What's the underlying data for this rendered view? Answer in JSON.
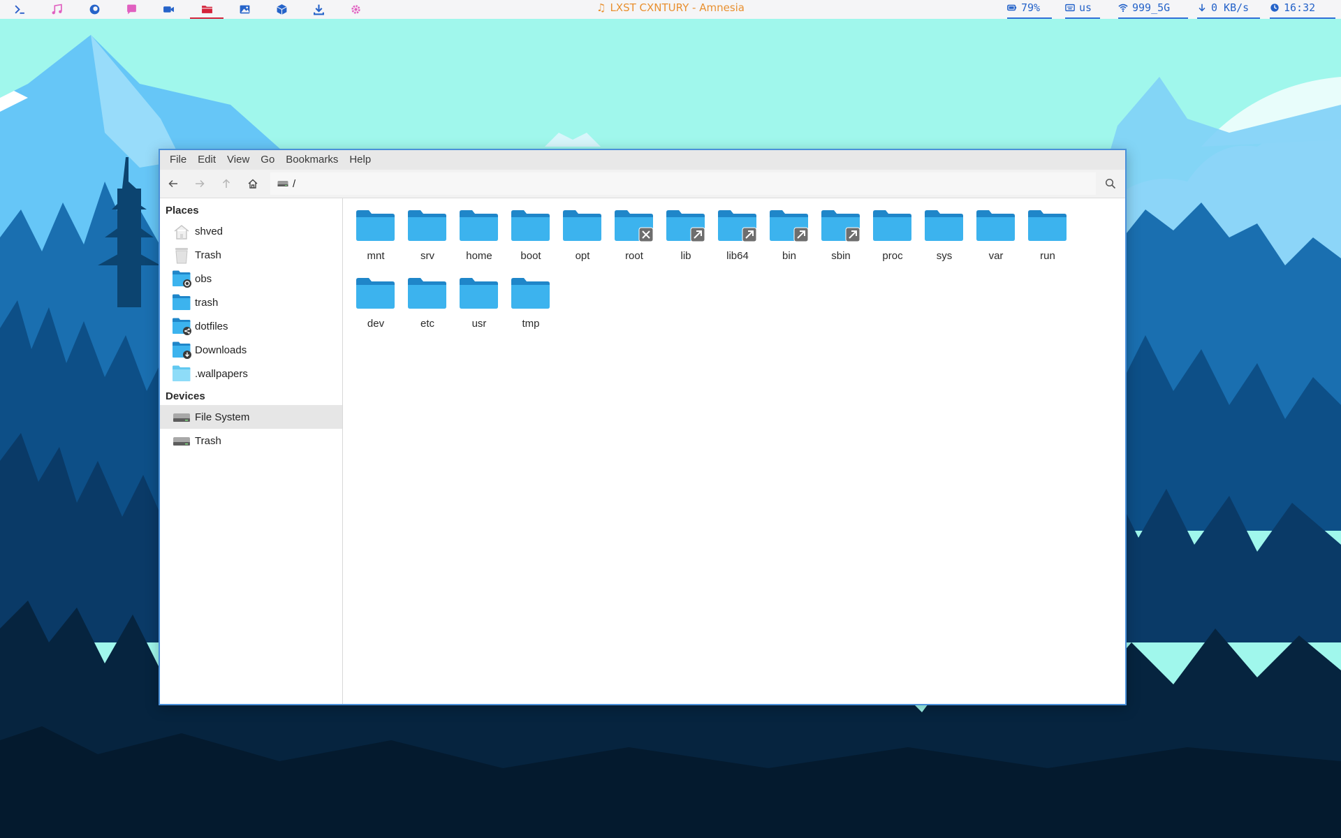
{
  "topbar": {
    "apps": [
      {
        "name": "terminal-icon",
        "color": "#2d5fc9"
      },
      {
        "name": "music-icon",
        "color": "#e060c0"
      },
      {
        "name": "firefox-icon",
        "color": "#2563c9"
      },
      {
        "name": "chat-icon",
        "color": "#e060c0"
      },
      {
        "name": "video-icon",
        "color": "#2563c9"
      },
      {
        "name": "folder-icon",
        "color": "#d4233a",
        "active": true
      },
      {
        "name": "image-icon",
        "color": "#2563c9"
      },
      {
        "name": "package-icon",
        "color": "#2563c9"
      },
      {
        "name": "download-icon",
        "color": "#2563c9"
      },
      {
        "name": "settings-icon",
        "color": "#e060c0"
      }
    ],
    "now_playing": "LXST CXNTURY - Amnesia",
    "battery": "79%",
    "keyboard": "us",
    "wifi": "999_5G",
    "network": "0 KB/s",
    "clock": "16:32"
  },
  "window": {
    "menu": [
      "File",
      "Edit",
      "View",
      "Go",
      "Bookmarks",
      "Help"
    ],
    "location_path": "/",
    "sidebar": {
      "places_heading": "Places",
      "places": [
        {
          "label": "shved",
          "icon": "home-icon"
        },
        {
          "label": "Trash",
          "icon": "trash-icon"
        },
        {
          "label": "obs",
          "icon": "folder-camera-icon"
        },
        {
          "label": "trash",
          "icon": "folder-icon"
        },
        {
          "label": "dotfiles",
          "icon": "folder-share-icon"
        },
        {
          "label": "Downloads",
          "icon": "folder-download-icon"
        },
        {
          "label": ".wallpapers",
          "icon": "folder-light-icon"
        }
      ],
      "devices_heading": "Devices",
      "devices": [
        {
          "label": "File System",
          "icon": "drive-icon",
          "selected": true
        },
        {
          "label": "Trash",
          "icon": "drive-icon"
        }
      ]
    },
    "files": [
      {
        "label": "mnt",
        "badge": ""
      },
      {
        "label": "srv",
        "badge": ""
      },
      {
        "label": "home",
        "badge": ""
      },
      {
        "label": "boot",
        "badge": ""
      },
      {
        "label": "opt",
        "badge": ""
      },
      {
        "label": "root",
        "badge": "locked"
      },
      {
        "label": "lib",
        "badge": "link"
      },
      {
        "label": "lib64",
        "badge": "link"
      },
      {
        "label": "bin",
        "badge": "link"
      },
      {
        "label": "sbin",
        "badge": "link"
      },
      {
        "label": "proc",
        "badge": ""
      },
      {
        "label": "sys",
        "badge": ""
      },
      {
        "label": "var",
        "badge": ""
      },
      {
        "label": "run",
        "badge": ""
      },
      {
        "label": "dev",
        "badge": ""
      },
      {
        "label": "etc",
        "badge": ""
      },
      {
        "label": "usr",
        "badge": ""
      },
      {
        "label": "tmp",
        "badge": ""
      }
    ]
  },
  "colors": {
    "folder_back": "#1f86c9",
    "folder_front": "#3cb3ee",
    "accent_border": "#4a90d9",
    "sky": "#a0f7ec"
  }
}
